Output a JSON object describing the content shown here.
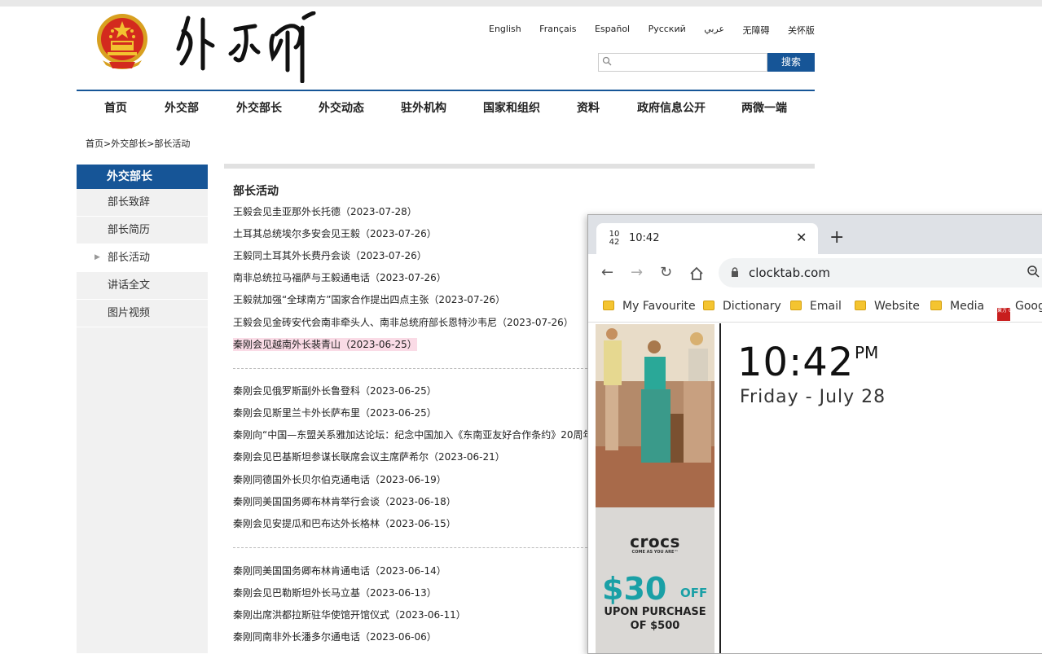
{
  "header": {
    "logo_text": "外交部",
    "languages": [
      "English",
      "Français",
      "Español",
      "Русский",
      "عربي",
      "无障碍",
      "关怀版"
    ],
    "search_placeholder": "",
    "search_button": "搜索"
  },
  "nav": [
    "首页",
    "外交部",
    "外交部长",
    "外交动态",
    "驻外机构",
    "国家和组织",
    "资料",
    "政府信息公开",
    "两微一端"
  ],
  "breadcrumb": "首页>外交部长>部长活动",
  "sidebar": {
    "title": "外交部长",
    "items": [
      "部长致辞",
      "部长简历",
      "部长活动",
      "讲话全文",
      "图片视频"
    ],
    "active_index": 2
  },
  "main": {
    "title": "部长活动",
    "group1": [
      "王毅会见圭亚那外长托德（2023-07-28）",
      "土耳其总统埃尔多安会见王毅（2023-07-26）",
      "王毅同土耳其外长费丹会谈（2023-07-26）",
      "南非总统拉马福萨与王毅通电话（2023-07-26）",
      "王毅就加强“全球南方”国家合作提出四点主张（2023-07-26）",
      "王毅会见金砖安代会南非牵头人、南非总统府部长恩特沙韦尼（2023-07-26）",
      "秦刚会见越南外长裴青山（2023-06-25）"
    ],
    "group2": [
      "秦刚会见俄罗斯副外长鲁登科（2023-06-25）",
      "秦刚会见斯里兰卡外长萨布里（2023-06-25）",
      "秦刚向“中国—东盟关系雅加达论坛：纪念中国加入《东南亚友好合作条约》20周年",
      "秦刚会见巴基斯坦参谋长联席会议主席萨希尔（2023-06-21）",
      "秦刚同德国外长贝尔伯克通电话（2023-06-19）",
      "秦刚同美国国务卿布林肯举行会谈（2023-06-18）",
      "秦刚会见安提瓜和巴布达外长格林（2023-06-15）"
    ],
    "group3": [
      "秦刚同美国国务卿布林肯通电话（2023-06-14）",
      "秦刚会见巴勒斯坦外长马立基（2023-06-13）",
      "秦刚出席洪都拉斯驻华使馆开馆仪式（2023-06-11）",
      "秦刚同南非外长潘多尔通电话（2023-06-06）"
    ]
  },
  "chrome": {
    "tab_favicon_top": "10",
    "tab_favicon_bottom": "42",
    "tab_title": "10:42",
    "url": "clocktab.com",
    "bookmarks": [
      "My Favourite",
      "Dictionary",
      "Email",
      "Website",
      "Media",
      "Goog"
    ],
    "bookmark_logo_text": "東方 ONLINE"
  },
  "clock": {
    "time": "10:42",
    "ampm": "PM",
    "date": "Friday - July 28"
  },
  "ad": {
    "brand": "crocs",
    "tagline": "COME AS YOU ARE™",
    "price": "$30",
    "off": "OFF",
    "line1": "UPON PURCHASE",
    "line2": "OF $500"
  },
  "colors": {
    "brand_blue": "#165597",
    "highlight": "#fadbe6",
    "ad_teal": "#1aa0a6"
  }
}
